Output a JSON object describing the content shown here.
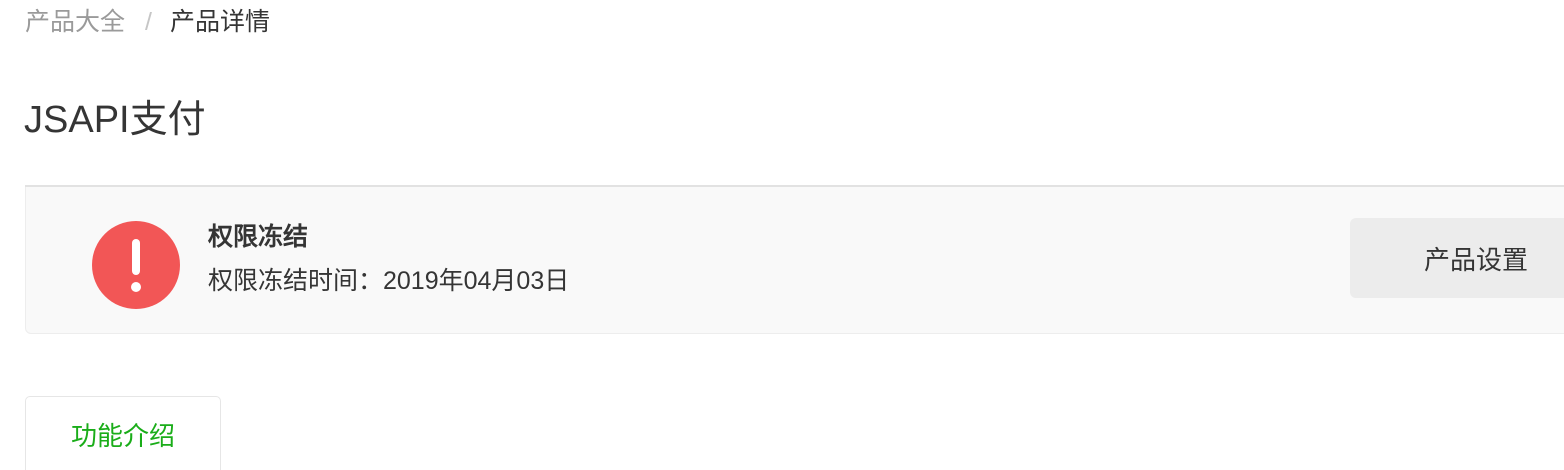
{
  "breadcrumb": {
    "items": [
      {
        "label": "产品大全"
      },
      {
        "label": "产品详情"
      }
    ],
    "separator": "/"
  },
  "page_title": "JSAPI支付",
  "status": {
    "icon": "exclamation-circle-icon",
    "icon_color": "#f25656",
    "title": "权限冻结",
    "detail": "权限冻结时间：2019年04月03日",
    "action_label": "产品设置"
  },
  "tabs": [
    {
      "label": "功能介绍",
      "active": true,
      "color": "#1aad19"
    }
  ]
}
